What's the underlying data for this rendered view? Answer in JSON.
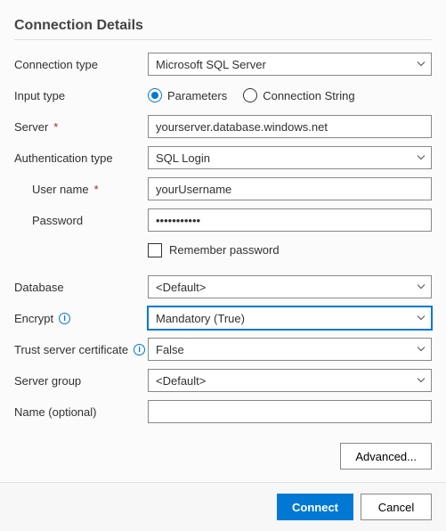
{
  "title": "Connection Details",
  "labels": {
    "connection_type": "Connection type",
    "input_type": "Input type",
    "server": "Server",
    "auth_type": "Authentication type",
    "username": "User name",
    "password": "Password",
    "remember": "Remember password",
    "database": "Database",
    "encrypt": "Encrypt",
    "trust_cert": "Trust server certificate",
    "server_group": "Server group",
    "name": "Name (optional)"
  },
  "values": {
    "connection_type": "Microsoft SQL Server",
    "server": "yourserver.database.windows.net",
    "auth_type": "SQL Login",
    "username": "yourUsername",
    "password": "•••••••••••",
    "database": "<Default>",
    "encrypt": "Mandatory (True)",
    "trust_cert": "False",
    "server_group": "<Default>",
    "name": ""
  },
  "input_type_options": {
    "parameters": "Parameters",
    "connection_string": "Connection String"
  },
  "buttons": {
    "advanced": "Advanced...",
    "connect": "Connect",
    "cancel": "Cancel"
  }
}
